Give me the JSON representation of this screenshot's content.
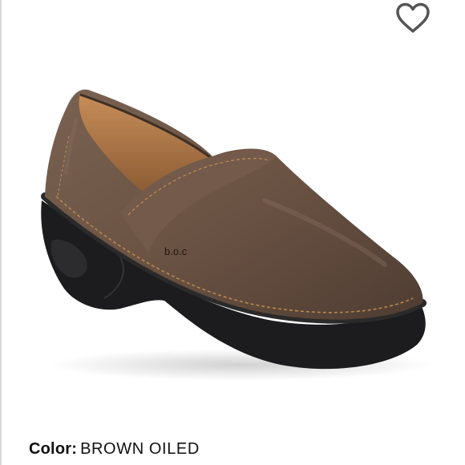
{
  "favorite": {
    "icon": "heart-outline-icon",
    "color": "#555555"
  },
  "product": {
    "image": {
      "subject": "brown leather clog",
      "logo_text": "b.o.c"
    },
    "color_label": "Color:",
    "color_value": "BROWN OILED"
  }
}
